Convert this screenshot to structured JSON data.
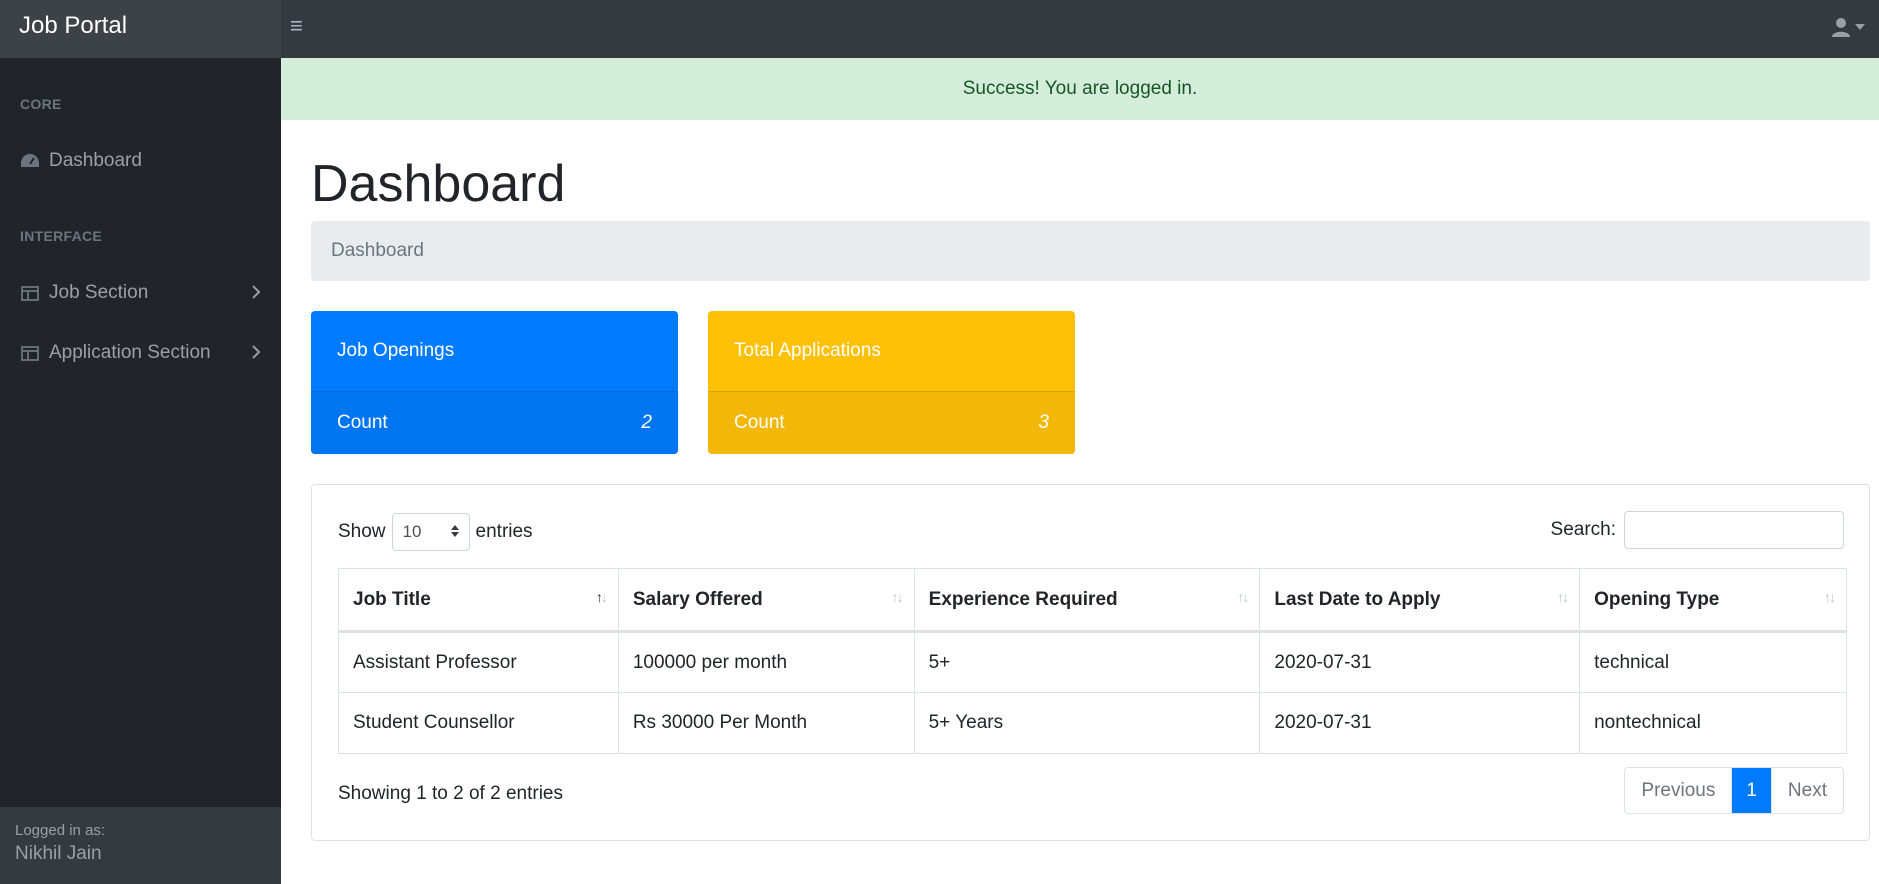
{
  "app": {
    "brand": "Job Portal"
  },
  "sidebar": {
    "heading_core": "CORE",
    "dashboard": "Dashboard",
    "heading_interface": "INTERFACE",
    "job_section": "Job Section",
    "application_section": "Application Section",
    "footer_label": "Logged in as:",
    "footer_user": "Nikhil Jain"
  },
  "alert": {
    "text": "Success! You are logged in."
  },
  "page": {
    "title": "Dashboard",
    "breadcrumb": "Dashboard"
  },
  "cards": [
    {
      "title": "Job Openings",
      "footer_label": "Count",
      "count": "2",
      "color": "#007bff"
    },
    {
      "title": "Total Applications",
      "footer_label": "Count",
      "count": "3",
      "color": "#ffc107"
    }
  ],
  "table": {
    "show_label": "Show",
    "length_value": "10",
    "entries_label": "entries",
    "search_label": "Search:",
    "columns": [
      "Job Title",
      "Salary Offered",
      "Experience Required",
      "Last Date to Apply",
      "Opening Type"
    ],
    "rows": [
      [
        "Assistant Professor",
        "100000 per month",
        "5+",
        "2020-07-31",
        "technical"
      ],
      [
        "Student Counsellor",
        "Rs 30000 Per Month",
        "5+ Years",
        "2020-07-31",
        "nontechnical"
      ]
    ],
    "info": "Showing 1 to 2 of 2 entries",
    "pagination": {
      "previous": "Previous",
      "current": "1",
      "next": "Next"
    }
  },
  "icons": [
    "menu-icon",
    "user-icon",
    "caret-down-icon",
    "tachometer-icon",
    "table-icon",
    "chevron-right-icon",
    "sort-icon"
  ]
}
